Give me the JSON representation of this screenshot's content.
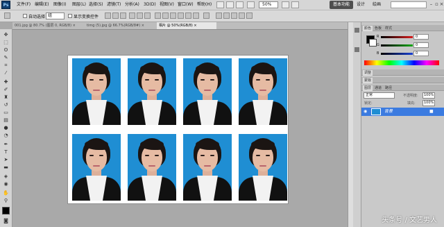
{
  "app": {
    "logo": "Ps"
  },
  "menu": [
    "文件(F)",
    "编辑(E)",
    "图像(I)",
    "图层(L)",
    "选择(S)",
    "滤镜(T)",
    "分析(A)",
    "3D(D)",
    "视图(V)",
    "窗口(W)",
    "帮助(H)"
  ],
  "zoom": "50%",
  "workspaces": {
    "active": "基本功能",
    "items": [
      "设计",
      "绘画"
    ]
  },
  "options": {
    "auto_select_label": "自动选择：",
    "auto_select_value": "组",
    "show_transform_label": "显示变换控件"
  },
  "tabs": [
    {
      "label": "001.jpg @ 80.7% (图层 0, RGB/8) ×",
      "active": false
    },
    {
      "label": "timg (5).jpg @ 66.7%(RGB/8#) ×",
      "active": false
    },
    {
      "label": "相片 @ 50%(RGB/8) ×",
      "active": true
    }
  ],
  "panels": {
    "color_tabs": [
      "颜色",
      "色板",
      "样式"
    ],
    "sliders": [
      {
        "channel": "R",
        "value": "0",
        "color": "#d91e1e"
      },
      {
        "channel": "G",
        "value": "0",
        "color": "#19a819"
      },
      {
        "channel": "B",
        "value": "0",
        "color": "#1a41d6"
      }
    ],
    "adjust_tabs": [
      "调整"
    ],
    "mask_tabs": [
      "蒙版"
    ],
    "layer_tabs": [
      "图层",
      "通道",
      "路径"
    ],
    "blend_mode": "正常",
    "opacity_label": "不透明度:",
    "opacity_value": "100%",
    "lock_label": "锁定:",
    "fill_label": "填充:",
    "fill_value": "100%",
    "layer": {
      "name": "背景"
    }
  },
  "canvas": {
    "background": "#ffffff",
    "photo_count": 8,
    "photo_background": "#1f8ed3"
  },
  "watermark": "头条号 / 文艺男人"
}
